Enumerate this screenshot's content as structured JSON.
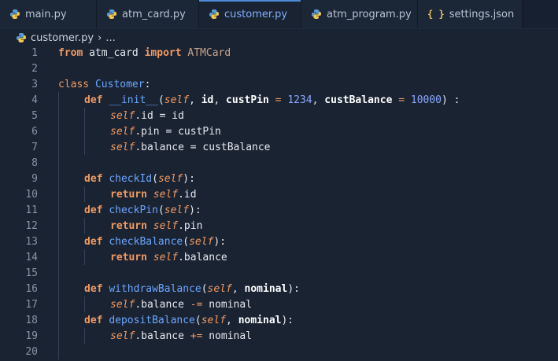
{
  "tabs": [
    {
      "label": "main.py",
      "icon": "python-icon",
      "modified": false,
      "active": false
    },
    {
      "label": "atm_card.py",
      "icon": "python-icon",
      "modified": true,
      "active": false
    },
    {
      "label": "customer.py",
      "icon": "python-icon",
      "modified": true,
      "active": true
    },
    {
      "label": "atm_program.py",
      "icon": "python-icon",
      "modified": false,
      "active": false
    },
    {
      "label": "settings.json",
      "icon": "json-braces-icon",
      "modified": false,
      "active": false
    }
  ],
  "breadcrumb": {
    "file": "customer.py",
    "separator": "›",
    "rest": "..."
  },
  "line_numbers": [
    "1",
    "2",
    "3",
    "4",
    "5",
    "6",
    "7",
    "8",
    "9",
    "10",
    "11",
    "12",
    "13",
    "14",
    "15",
    "16",
    "17",
    "18",
    "19",
    "20"
  ],
  "code": {
    "l1": {
      "from": "from",
      "module": "atm_card",
      "import": "import",
      "name": "ATMCard"
    },
    "l3": {
      "class": "class",
      "name": "Customer",
      "colon": ":"
    },
    "l4": {
      "def": "def",
      "name": "__init__",
      "open": "(",
      "self": "self",
      "c1": ", ",
      "p1": "id",
      "c2": ", ",
      "p2": "custPin",
      "eq1": " = ",
      "v2": "1234",
      "c3": ", ",
      "p3": "custBalance",
      "eq2": " = ",
      "v3": "10000",
      "close": ") :"
    },
    "l5": {
      "self": "self",
      "rest": ".id = id"
    },
    "l6": {
      "self": "self",
      "rest": ".pin = custPin"
    },
    "l7": {
      "self": "self",
      "rest": ".balance = custBalance"
    },
    "l9": {
      "def": "def",
      "name": "checkId",
      "open": "(",
      "self": "self",
      "close": "):"
    },
    "l10": {
      "ret": "return",
      "self": "self",
      "rest": ".id"
    },
    "l11": {
      "def": "def",
      "name": "checkPin",
      "open": "(",
      "self": "self",
      "close": "):"
    },
    "l12": {
      "ret": "return",
      "self": "self",
      "rest": ".pin"
    },
    "l13": {
      "def": "def",
      "name": "checkBalance",
      "open": "(",
      "self": "self",
      "close": "):"
    },
    "l14": {
      "ret": "return",
      "self": "self",
      "rest": ".balance"
    },
    "l16": {
      "def": "def",
      "name": "withdrawBalance",
      "open": "(",
      "self": "self",
      "comma": ", ",
      "param": "nominal",
      "close": "):"
    },
    "l17": {
      "self": "self",
      "mid": ".balance ",
      "op": "-=",
      "rest": " nominal"
    },
    "l18": {
      "def": "def",
      "name": "depositBalance",
      "open": "(",
      "self": "self",
      "comma": ", ",
      "param": "nominal",
      "close": "):"
    },
    "l19": {
      "self": "self",
      "mid": ".balance ",
      "op": "+=",
      "rest": " nominal"
    }
  }
}
